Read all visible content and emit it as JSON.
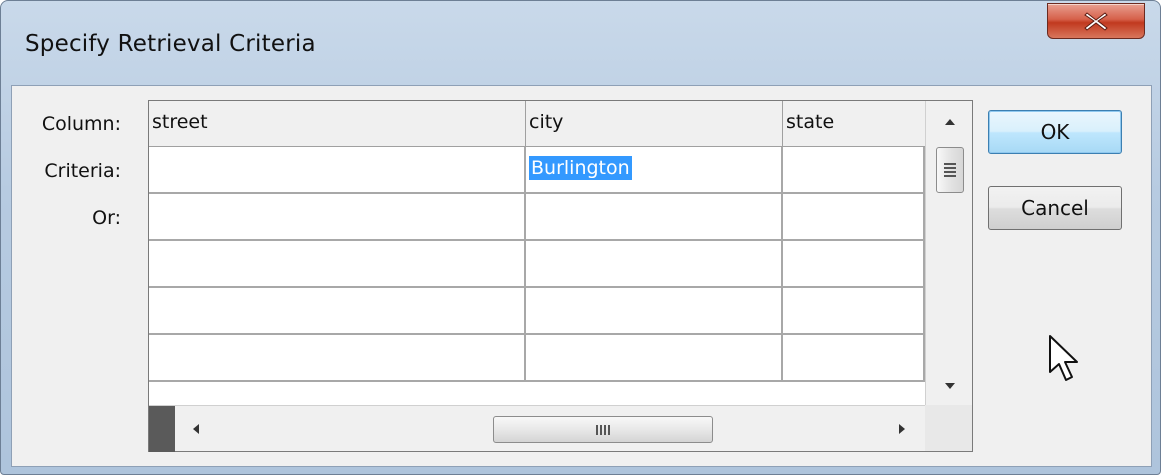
{
  "window": {
    "title": "Specify Retrieval Criteria"
  },
  "labels": {
    "column": "Column:",
    "criteria": "Criteria:",
    "or": "Or:"
  },
  "grid": {
    "columns": [
      "street",
      "city",
      "state"
    ],
    "rows": [
      [
        "",
        "Burlington",
        ""
      ],
      [
        "",
        "",
        ""
      ],
      [
        "",
        "",
        ""
      ],
      [
        "",
        "",
        ""
      ],
      [
        "",
        "",
        ""
      ]
    ],
    "selected_cell_text": "Burlington",
    "scroll_grip": "III"
  },
  "buttons": {
    "ok": "OK",
    "cancel": "Cancel"
  },
  "colors": {
    "selection": "#3399ff",
    "close_button": "#c1391f",
    "default_button_border": "#3c7fb1"
  },
  "icons": {
    "close": "close-x-icon",
    "cursor": "mouse-pointer-icon"
  }
}
